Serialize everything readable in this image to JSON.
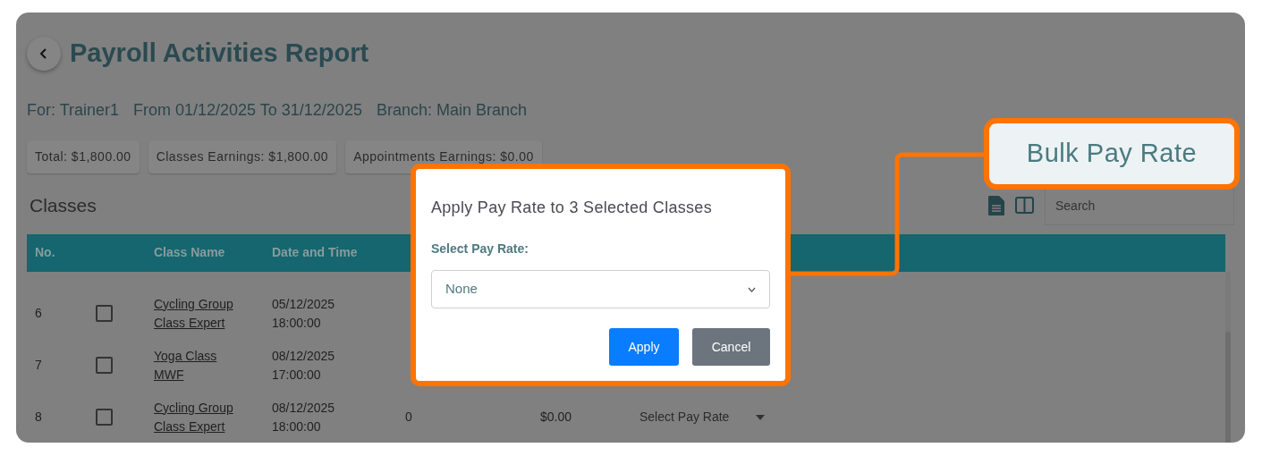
{
  "page": {
    "title": "Payroll Activities Report",
    "info": [
      "For: Trainer1",
      "From 01/12/2025 To 31/12/2025",
      "Branch: Main Branch"
    ],
    "summary_chips": [
      "Total: $1,800.00",
      "Classes Earnings: $1,800.00",
      "Appointments Earnings: $0.00"
    ],
    "section_title": "Classes",
    "search": {
      "placeholder": "Search"
    },
    "table": {
      "columns": [
        "No.",
        "",
        "Class Name",
        "Date and Time"
      ],
      "rows": [
        {
          "no": "6",
          "checked": false,
          "class_name": [
            "Cycling Group",
            "Class Expert"
          ],
          "date_time": [
            "05/12/2025",
            "18:00:00"
          ]
        },
        {
          "no": "7",
          "checked": false,
          "class_name": [
            "Yoga Class",
            "MWF"
          ],
          "date_time": [
            "08/12/2025",
            "17:00:00"
          ]
        },
        {
          "no": "8",
          "checked": false,
          "class_name": [
            "Cycling Group",
            "Class Expert"
          ],
          "date_time": [
            "08/12/2025",
            "18:00:00"
          ],
          "column_4": "0",
          "amount": "$0.00",
          "pay_rate": "Select Pay Rate"
        }
      ]
    }
  },
  "dialog": {
    "title": "Apply Pay Rate to 3 Selected Classes",
    "field_label": "Select Pay Rate:",
    "select_value": "None",
    "buttons": [
      {
        "label": "Apply",
        "kind": "primary"
      },
      {
        "label": "Cancel",
        "kind": "secondary"
      }
    ]
  },
  "callout": {
    "label": "Bulk Pay Rate"
  }
}
